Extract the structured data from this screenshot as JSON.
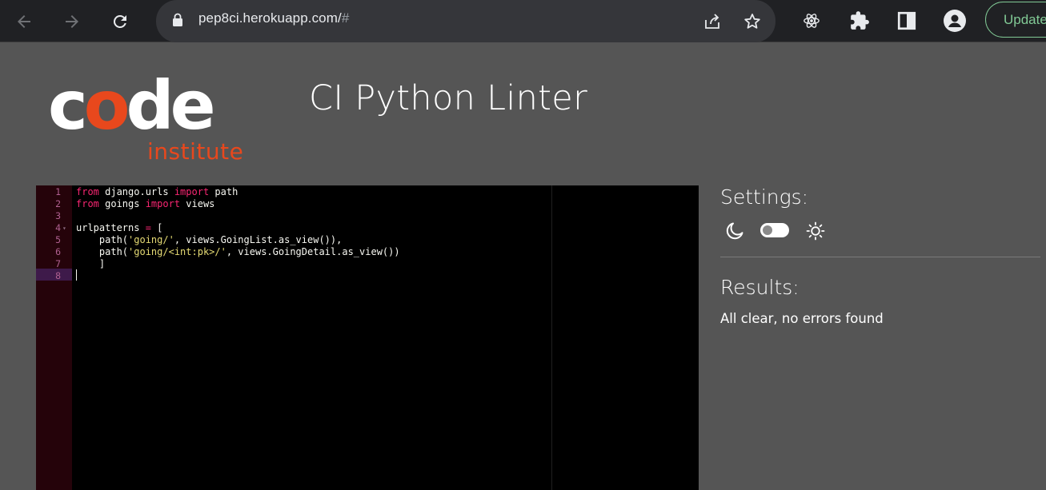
{
  "browser": {
    "url_host": "pep8ci.herokuapp.com/",
    "url_hash": "#",
    "update_label": "Update"
  },
  "logo": {
    "word_before": "c",
    "word_highlight": "o",
    "word_after": "de",
    "subtitle": "institute"
  },
  "page": {
    "title": "CI Python Linter"
  },
  "editor": {
    "lines": [
      {
        "n": "1",
        "fold": "",
        "tokens": [
          {
            "t": "from",
            "c": "kw"
          },
          {
            "t": " django.urls ",
            "c": ""
          },
          {
            "t": "import",
            "c": "kw"
          },
          {
            "t": " path",
            "c": ""
          }
        ]
      },
      {
        "n": "2",
        "fold": "",
        "tokens": [
          {
            "t": "from",
            "c": "kw"
          },
          {
            "t": " goings ",
            "c": ""
          },
          {
            "t": "import",
            "c": "kw"
          },
          {
            "t": " views",
            "c": ""
          }
        ]
      },
      {
        "n": "3",
        "fold": "",
        "tokens": []
      },
      {
        "n": "4",
        "fold": "▾",
        "tokens": [
          {
            "t": "urlpatterns ",
            "c": ""
          },
          {
            "t": "=",
            "c": "op"
          },
          {
            "t": " [",
            "c": ""
          }
        ]
      },
      {
        "n": "5",
        "fold": "",
        "tokens": [
          {
            "t": "    path(",
            "c": ""
          },
          {
            "t": "'going/'",
            "c": "str"
          },
          {
            "t": ", views.GoingList.as_view()),",
            "c": ""
          }
        ]
      },
      {
        "n": "6",
        "fold": "",
        "tokens": [
          {
            "t": "    path(",
            "c": ""
          },
          {
            "t": "'going/<int:pk>/'",
            "c": "str"
          },
          {
            "t": ", views.GoingDetail.as_view())",
            "c": ""
          }
        ]
      },
      {
        "n": "7",
        "fold": "",
        "tokens": [
          {
            "t": "    ]",
            "c": ""
          }
        ]
      },
      {
        "n": "8",
        "fold": "",
        "tokens": []
      }
    ]
  },
  "settings": {
    "title": "Settings:",
    "theme_dark_icon": "moon-icon",
    "theme_light_icon": "sun-icon",
    "toggle_state": "dark"
  },
  "results": {
    "title": "Results:",
    "message": "All clear, no errors found"
  },
  "colors": {
    "accent": "#e8481d",
    "update_green": "#81c995",
    "page_bg": "#555555",
    "editor_bg": "#000000"
  }
}
